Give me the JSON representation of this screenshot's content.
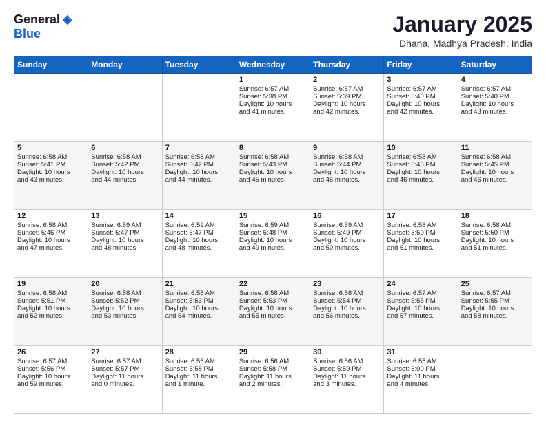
{
  "header": {
    "logo_general": "General",
    "logo_blue": "Blue",
    "title": "January 2025",
    "location": "Dhana, Madhya Pradesh, India"
  },
  "days_of_week": [
    "Sunday",
    "Monday",
    "Tuesday",
    "Wednesday",
    "Thursday",
    "Friday",
    "Saturday"
  ],
  "weeks": [
    [
      {
        "day": "",
        "text": ""
      },
      {
        "day": "",
        "text": ""
      },
      {
        "day": "",
        "text": ""
      },
      {
        "day": "1",
        "text": "Sunrise: 6:57 AM\nSunset: 5:38 PM\nDaylight: 10 hours\nand 41 minutes."
      },
      {
        "day": "2",
        "text": "Sunrise: 6:57 AM\nSunset: 5:39 PM\nDaylight: 10 hours\nand 42 minutes."
      },
      {
        "day": "3",
        "text": "Sunrise: 6:57 AM\nSunset: 5:40 PM\nDaylight: 10 hours\nand 42 minutes."
      },
      {
        "day": "4",
        "text": "Sunrise: 6:57 AM\nSunset: 5:40 PM\nDaylight: 10 hours\nand 43 minutes."
      }
    ],
    [
      {
        "day": "5",
        "text": "Sunrise: 6:58 AM\nSunset: 5:41 PM\nDaylight: 10 hours\nand 43 minutes."
      },
      {
        "day": "6",
        "text": "Sunrise: 6:58 AM\nSunset: 5:42 PM\nDaylight: 10 hours\nand 44 minutes."
      },
      {
        "day": "7",
        "text": "Sunrise: 6:58 AM\nSunset: 5:42 PM\nDaylight: 10 hours\nand 44 minutes."
      },
      {
        "day": "8",
        "text": "Sunrise: 6:58 AM\nSunset: 5:43 PM\nDaylight: 10 hours\nand 45 minutes."
      },
      {
        "day": "9",
        "text": "Sunrise: 6:58 AM\nSunset: 5:44 PM\nDaylight: 10 hours\nand 45 minutes."
      },
      {
        "day": "10",
        "text": "Sunrise: 6:58 AM\nSunset: 5:45 PM\nDaylight: 10 hours\nand 46 minutes."
      },
      {
        "day": "11",
        "text": "Sunrise: 6:58 AM\nSunset: 5:45 PM\nDaylight: 10 hours\nand 46 minutes."
      }
    ],
    [
      {
        "day": "12",
        "text": "Sunrise: 6:58 AM\nSunset: 5:46 PM\nDaylight: 10 hours\nand 47 minutes."
      },
      {
        "day": "13",
        "text": "Sunrise: 6:59 AM\nSunset: 5:47 PM\nDaylight: 10 hours\nand 48 minutes."
      },
      {
        "day": "14",
        "text": "Sunrise: 6:59 AM\nSunset: 5:47 PM\nDaylight: 10 hours\nand 48 minutes."
      },
      {
        "day": "15",
        "text": "Sunrise: 6:59 AM\nSunset: 5:48 PM\nDaylight: 10 hours\nand 49 minutes."
      },
      {
        "day": "16",
        "text": "Sunrise: 6:59 AM\nSunset: 5:49 PM\nDaylight: 10 hours\nand 50 minutes."
      },
      {
        "day": "17",
        "text": "Sunrise: 6:58 AM\nSunset: 5:50 PM\nDaylight: 10 hours\nand 51 minutes."
      },
      {
        "day": "18",
        "text": "Sunrise: 6:58 AM\nSunset: 5:50 PM\nDaylight: 10 hours\nand 51 minutes."
      }
    ],
    [
      {
        "day": "19",
        "text": "Sunrise: 6:58 AM\nSunset: 5:51 PM\nDaylight: 10 hours\nand 52 minutes."
      },
      {
        "day": "20",
        "text": "Sunrise: 6:58 AM\nSunset: 5:52 PM\nDaylight: 10 hours\nand 53 minutes."
      },
      {
        "day": "21",
        "text": "Sunrise: 6:58 AM\nSunset: 5:53 PM\nDaylight: 10 hours\nand 54 minutes."
      },
      {
        "day": "22",
        "text": "Sunrise: 6:58 AM\nSunset: 5:53 PM\nDaylight: 10 hours\nand 55 minutes."
      },
      {
        "day": "23",
        "text": "Sunrise: 6:58 AM\nSunset: 5:54 PM\nDaylight: 10 hours\nand 56 minutes."
      },
      {
        "day": "24",
        "text": "Sunrise: 6:57 AM\nSunset: 5:55 PM\nDaylight: 10 hours\nand 57 minutes."
      },
      {
        "day": "25",
        "text": "Sunrise: 6:57 AM\nSunset: 5:55 PM\nDaylight: 10 hours\nand 58 minutes."
      }
    ],
    [
      {
        "day": "26",
        "text": "Sunrise: 6:57 AM\nSunset: 5:56 PM\nDaylight: 10 hours\nand 59 minutes."
      },
      {
        "day": "27",
        "text": "Sunrise: 6:57 AM\nSunset: 5:57 PM\nDaylight: 11 hours\nand 0 minutes."
      },
      {
        "day": "28",
        "text": "Sunrise: 6:56 AM\nSunset: 5:58 PM\nDaylight: 11 hours\nand 1 minute."
      },
      {
        "day": "29",
        "text": "Sunrise: 6:56 AM\nSunset: 5:58 PM\nDaylight: 11 hours\nand 2 minutes."
      },
      {
        "day": "30",
        "text": "Sunrise: 6:56 AM\nSunset: 5:59 PM\nDaylight: 11 hours\nand 3 minutes."
      },
      {
        "day": "31",
        "text": "Sunrise: 6:55 AM\nSunset: 6:00 PM\nDaylight: 11 hours\nand 4 minutes."
      },
      {
        "day": "",
        "text": ""
      }
    ]
  ]
}
